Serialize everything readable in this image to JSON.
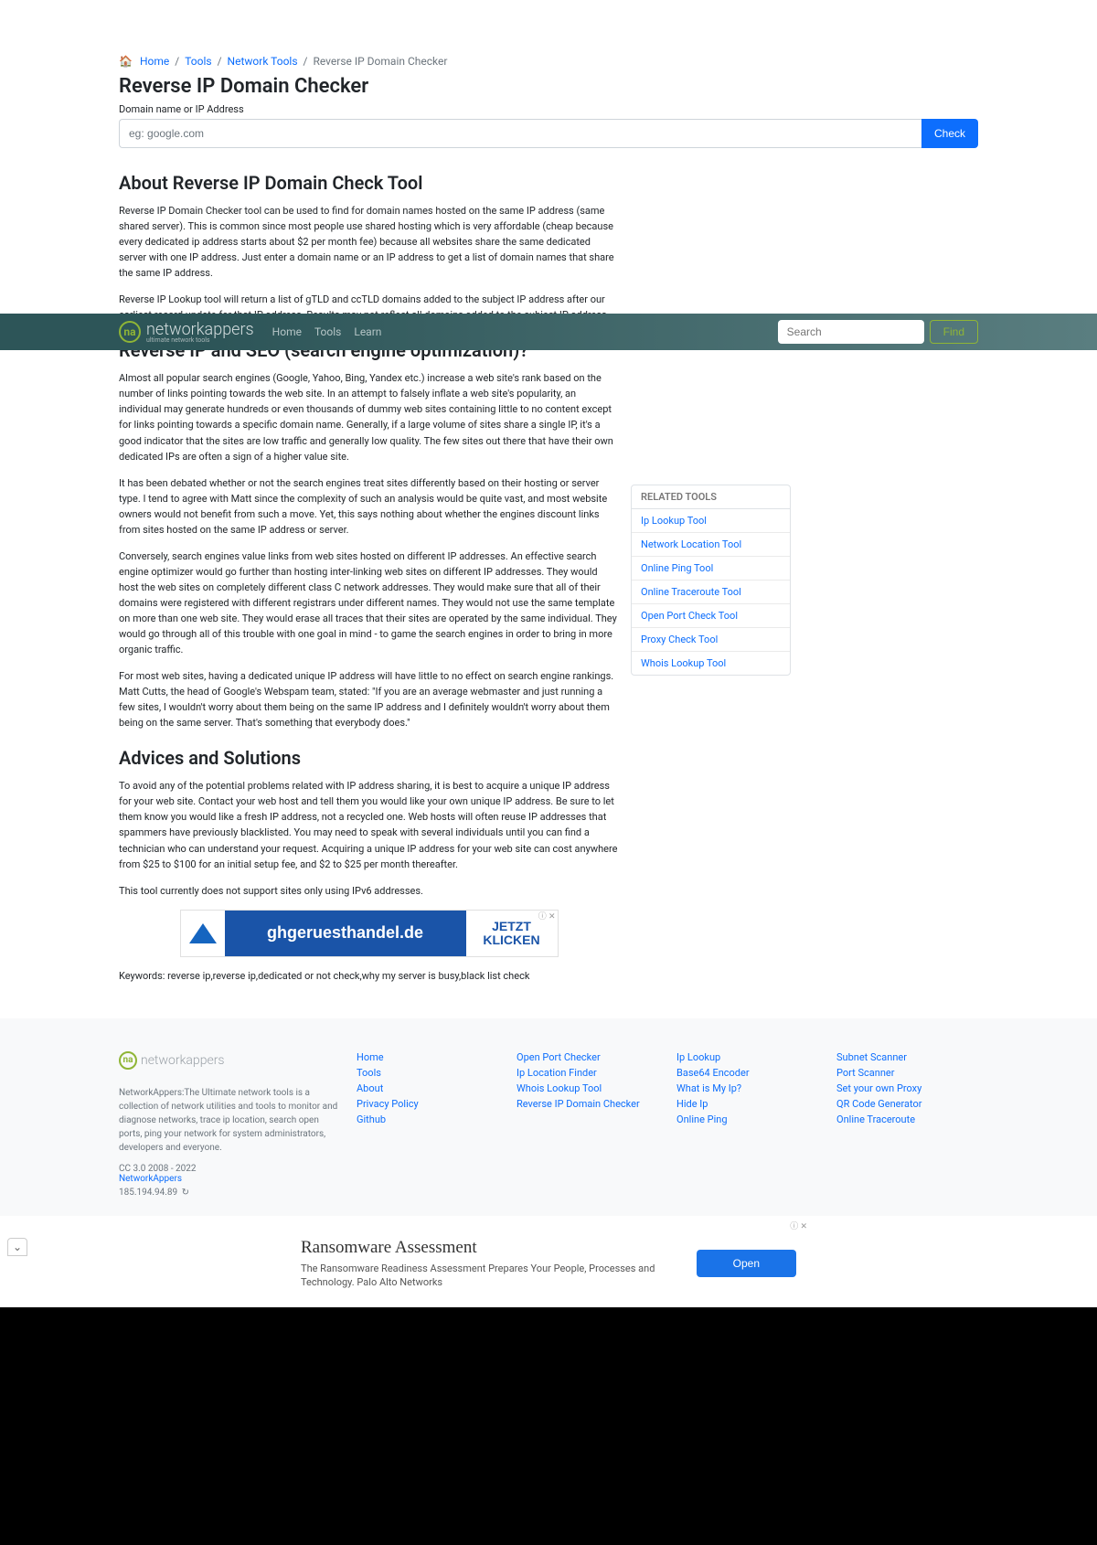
{
  "breadcrumb": {
    "home": "Home",
    "tools": "Tools",
    "network_tools": "Network Tools",
    "current": "Reverse IP Domain Checker"
  },
  "page": {
    "title": "Reverse IP Domain Checker",
    "field_label": "Domain name or IP Address",
    "placeholder": "eg: google.com",
    "check": "Check"
  },
  "about": {
    "heading": "About Reverse IP Domain Check Tool",
    "p1": "Reverse IP Domain Checker tool can be used to find for domain names hosted on the same IP address (same shared server). This is common since most people use shared hosting which is very affordable (cheap because every dedicated ip address starts about $2 per month fee) because all websites share the same dedicated server with one IP address. Just enter a domain name or an IP address to get a list of domain names that share the same IP address.",
    "p2": "Reverse IP Lookup tool will return a list of gTLD and ccTLD domains added to the subject IP address after our earliest record update for that IP address. Results may not reflect all domains added to the subject IP address."
  },
  "seo": {
    "heading": "Reverse IP and SEO (search engine optimization)?",
    "p1": "Almost all popular search engines (Google, Yahoo, Bing, Yandex etc.) increase a web site's rank based on the number of links pointing towards the web site. In an attempt to falsely inflate a web site's popularity, an individual may generate hundreds or even thousands of dummy web sites containing little to no content except for links pointing towards a specific domain name. Generally, if a large volume of sites share a single IP, it's a good indicator that the sites are low traffic and generally low quality. The few sites out there that have their own dedicated IPs are often a sign of a higher value site.",
    "p2": "It has been debated whether or not the search engines treat sites differently based on their hosting or server type. I tend to agree with Matt since the complexity of such an analysis would be quite vast, and most website owners would not benefit from such a move. Yet, this says nothing about whether the engines discount links from sites hosted on the same IP address or server.",
    "p3": "Conversely, search engines value links from web sites hosted on different IP addresses. An effective search engine optimizer would go further than hosting inter-linking web sites on different IP addresses. They would host the web sites on completely different class C network addresses. They would make sure that all of their domains were registered with different registrars under different names. They would not use the same template on more than one web site. They would erase all traces that their sites are operated by the same individual. They would go through all of this trouble with one goal in mind - to game the search engines in order to bring in more organic traffic.",
    "p4": "For most web sites, having a dedicated unique IP address will have little to no effect on search engine rankings. Matt Cutts, the head of Google's Webspam team, stated: \"If you are an average webmaster and just running a few sites, I wouldn't worry about them being on the same IP address and I definitely wouldn't worry about them being on the same server. That's something that everybody does.\""
  },
  "advice": {
    "heading": "Advices and Solutions",
    "p1": "To avoid any of the potential problems related with IP address sharing, it is best to acquire a unique IP address for your web site. Contact your web host and tell them you would like your own unique IP address. Be sure to let them know you would like a fresh IP address, not a recycled one. Web hosts will often reuse IP addresses that spammers have previously blacklisted. You may need to speak with several individuals until you can find a technician who can understand your request. Acquiring a unique IP address for your web site can cost anywhere from $25 to $100 for an initial setup fee, and $2 to $25 per month thereafter.",
    "p2": "This tool currently does not support sites only using IPv6 addresses."
  },
  "ad1": {
    "domain": "ghgeruesthandel.de",
    "cta1": "JETZT",
    "cta2": "KLICKEN",
    "tag": "ⓘ ✕"
  },
  "keywords": "Keywords: reverse ip,reverse ip,dedicated or not check,why my server is busy,black list check",
  "nav": {
    "brand": "networkappers",
    "tagline": "ultimate network tools",
    "home": "Home",
    "tools": "Tools",
    "learn": "Learn",
    "search_placeholder": "Search",
    "find": "Find"
  },
  "sidebar": {
    "title": "RELATED TOOLS",
    "items": [
      "Ip Lookup Tool",
      "Network Location Tool",
      "Online Ping Tool",
      "Online Traceroute Tool",
      "Open Port Check Tool",
      "Proxy Check Tool",
      "Whois Lookup Tool"
    ]
  },
  "footer": {
    "brand": "networkappers",
    "desc": "NetworkAppers:The Ultimate network tools is a collection of network utilities and tools to monitor and diagnose networks, trace ip location, search open ports, ping your network for system administrators, developers and everyone.",
    "cc": "CC 3.0 2008 - 2022 ",
    "cc_link": "NetworkAppers",
    "ip": "185.194.94.89",
    "col1": [
      "Home",
      "Tools",
      "About",
      "Privacy Policy",
      "Github"
    ],
    "col2": [
      "Open Port Checker",
      "Ip Location Finder",
      "Whois Lookup Tool",
      "Reverse IP Domain Checker"
    ],
    "col3": [
      "Ip Lookup",
      "Base64 Encoder",
      "What is My Ip?",
      "Hide Ip",
      "Online Ping"
    ],
    "col4": [
      "Subnet Scanner",
      "Port Scanner",
      "Set your own Proxy",
      "QR Code Generator",
      "Online Traceroute"
    ]
  },
  "ad2": {
    "title": "Ransomware Assessment",
    "sub": "The Ransomware Readiness Assessment Prepares Your People, Processes and Technology. Palo Alto Networks",
    "open": "Open",
    "tag": "ⓘ ✕"
  }
}
